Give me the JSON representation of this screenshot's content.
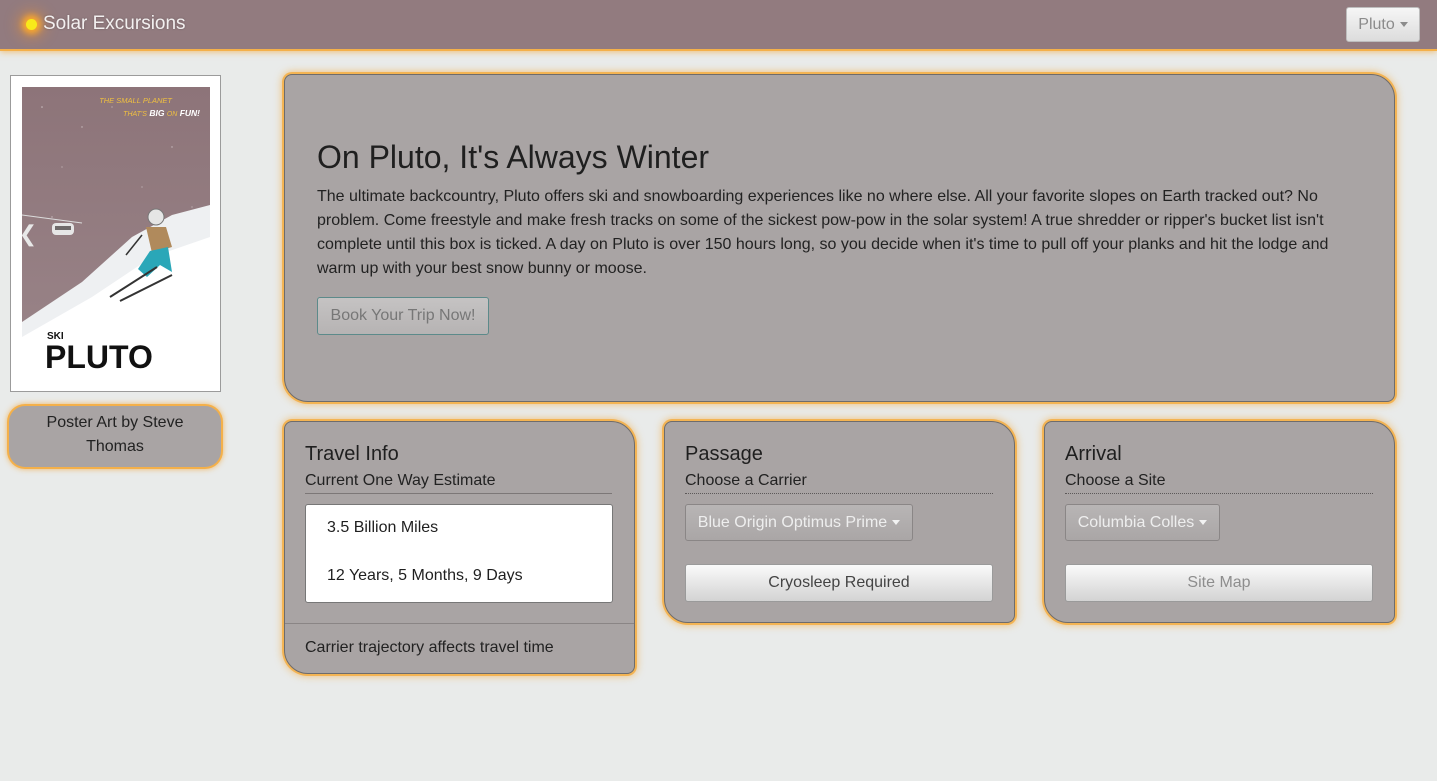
{
  "navbar": {
    "brand": "Solar Excursions",
    "planet_selected": "Pluto"
  },
  "poster": {
    "tagline_line1": "THE SMALL PLANET",
    "tagline_that": "THAT'S",
    "tagline_big": "BIG",
    "tagline_on": "ON",
    "tagline_fun": "FUN!",
    "ski": "SKI",
    "title": "PLUTO",
    "credit": "Poster Art by  Steve Thomas"
  },
  "jumbotron": {
    "title": "On Pluto, It's Always Winter",
    "text": "The ultimate backcountry, Pluto offers ski and snowboarding experiences like no where else. All your favorite slopes on Earth tracked out? No problem. Come freestyle and make fresh tracks on some of the sickest pow-pow in the solar system! A true shredder or ripper's bucket list isn't complete until this box is ticked. A day on Pluto is over 150 hours long, so you decide when it's time to pull off your planks and hit the lodge and warm up with your best snow bunny or moose.",
    "button": "Book Your Trip Now!"
  },
  "travel": {
    "title": "Travel Info",
    "subtitle": "Current One Way Estimate",
    "distance": "3.5 Billion Miles",
    "duration": "12 Years, 5 Months, 9 Days",
    "footer": "Carrier trajectory affects travel time"
  },
  "passage": {
    "title": "Passage",
    "subtitle": "Choose a Carrier",
    "carrier": "Blue Origin Optimus Prime",
    "button": "Cryosleep Required"
  },
  "arrival": {
    "title": "Arrival",
    "subtitle": "Choose a Site",
    "site": "Columbia Colles",
    "button": "Site Map"
  },
  "colors": {
    "navbar": "#927b7f",
    "card": "#a9a4a4",
    "glow": "#f4b04a",
    "page": "#e9ebea"
  }
}
